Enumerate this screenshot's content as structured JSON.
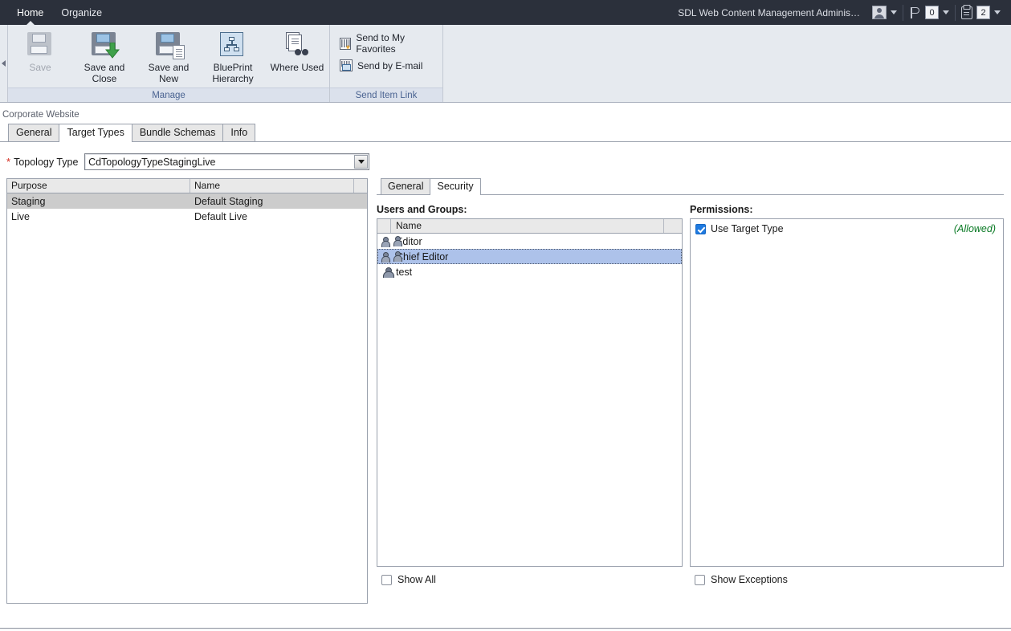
{
  "titlebar": {
    "tabs": [
      {
        "label": "Home",
        "active": true
      },
      {
        "label": "Organize",
        "active": false
      }
    ],
    "app_name": "SDL Web Content Management Adminis…",
    "avatar_icon": "user-avatar-icon",
    "flag_icon": "flag-icon",
    "flag_count": "0",
    "clipboard_icon": "clipboard-icon",
    "clipboard_count": "2",
    "background_color": "#2b303b"
  },
  "ribbon": {
    "groups": [
      {
        "label": "Manage",
        "buttons": [
          {
            "label": "Save",
            "icon": "floppy-disk-icon",
            "disabled": true
          },
          {
            "label": "Save and Close",
            "icon": "floppy-disk-arrow-icon",
            "disabled": false
          },
          {
            "label": "Save and New",
            "icon": "floppy-disk-page-icon",
            "disabled": false
          },
          {
            "label": "BluePrint Hierarchy",
            "icon": "blueprint-hierarchy-icon",
            "disabled": false
          },
          {
            "label": "Where Used",
            "icon": "where-used-binoculars-icon",
            "disabled": false
          }
        ]
      },
      {
        "label": "Send Item Link",
        "small_buttons": [
          {
            "label": "Send to My Favorites",
            "icon": "send-to-favorites-icon"
          },
          {
            "label": "Send by E-mail",
            "icon": "send-by-email-icon"
          }
        ]
      }
    ]
  },
  "breadcrumb": "Corporate Website",
  "tabs": [
    {
      "label": "General",
      "active": false
    },
    {
      "label": "Target Types",
      "active": true
    },
    {
      "label": "Bundle Schemas",
      "active": false
    },
    {
      "label": "Info",
      "active": false
    }
  ],
  "topology": {
    "required_marker": "*",
    "label": "Topology Type",
    "value": "CdTopologyTypeStagingLive",
    "dropdown_icon": "chevron-down-icon"
  },
  "purpose_grid": {
    "columns": [
      "Purpose",
      "Name",
      ""
    ],
    "rows": [
      {
        "purpose": "Staging",
        "name": "Default Staging",
        "selected": true
      },
      {
        "purpose": "Live",
        "name": "Default Live",
        "selected": false
      }
    ]
  },
  "detail_tabs": [
    {
      "label": "General",
      "active": false
    },
    {
      "label": "Security",
      "active": true
    }
  ],
  "users_panel": {
    "title": "Users and Groups:",
    "columns": [
      "",
      "Name",
      ""
    ],
    "rows": [
      {
        "name": "Editor",
        "icon": "group-icon",
        "selected": false
      },
      {
        "name": "Chief Editor",
        "icon": "group-icon",
        "selected": true
      },
      {
        "name": "test",
        "icon": "user-icon",
        "selected": false
      }
    ],
    "show_all": {
      "label": "Show All",
      "checked": false
    }
  },
  "permissions_panel": {
    "title": "Permissions:",
    "rows": [
      {
        "name": "Use Target Type",
        "checked": true,
        "status": "(Allowed)",
        "status_color": "#0a7a25"
      }
    ],
    "show_exceptions": {
      "label": "Show Exceptions",
      "checked": false
    }
  }
}
